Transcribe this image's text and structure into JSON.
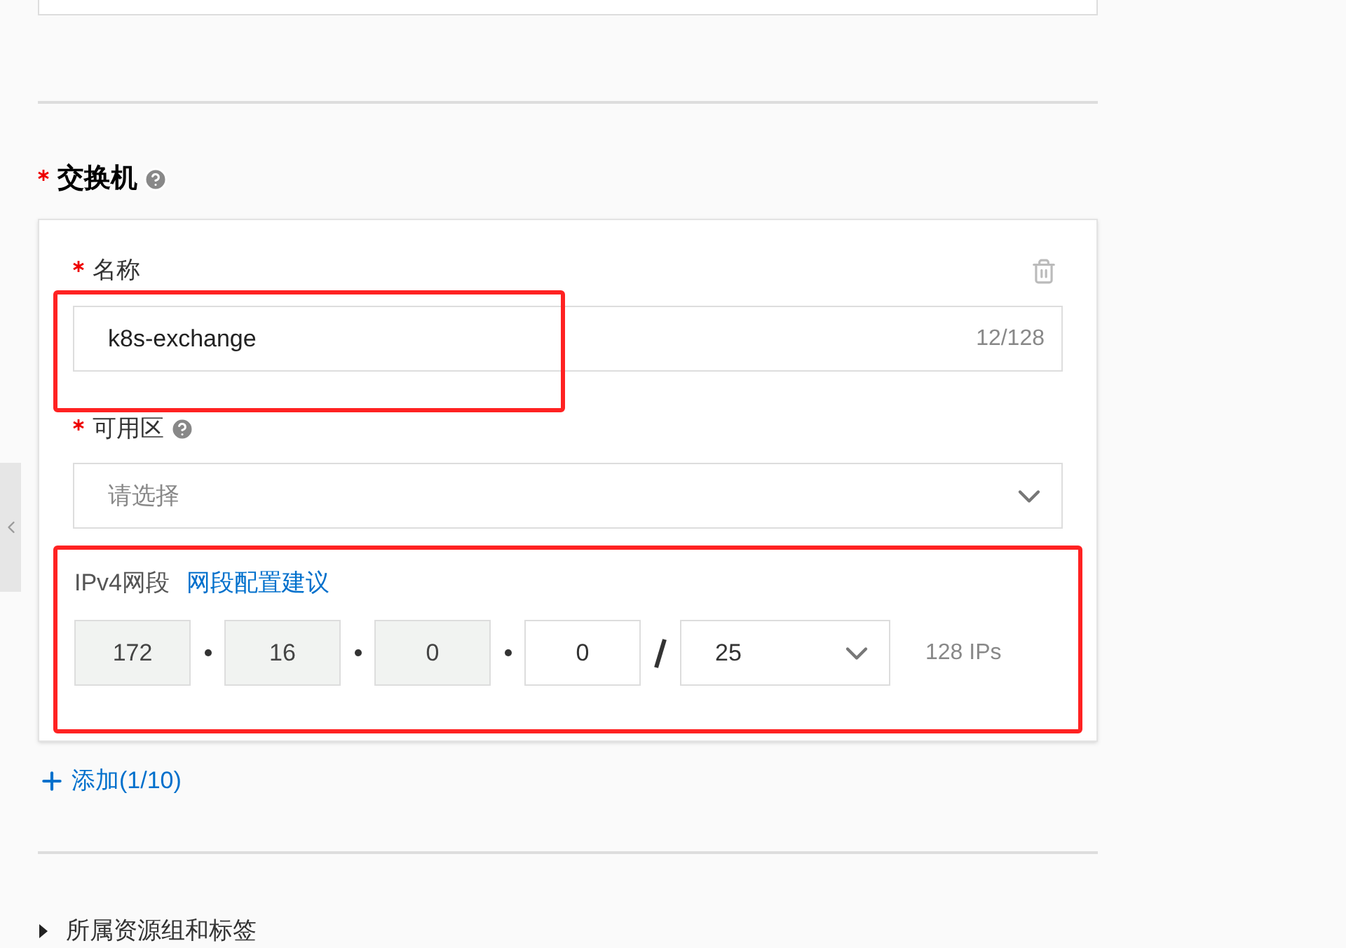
{
  "switch_section": {
    "title": "交换机",
    "required": true,
    "name_field": {
      "label": "名称",
      "required": true,
      "value": "k8s-exchange",
      "counter": "12/128"
    },
    "zone_field": {
      "label": "可用区",
      "required": true,
      "placeholder": "请选择"
    },
    "ipv4": {
      "label": "IPv4网段",
      "link": "网段配置建议",
      "octets": [
        {
          "value": "172",
          "disabled": true
        },
        {
          "value": "16",
          "disabled": true
        },
        {
          "value": "0",
          "disabled": true
        },
        {
          "value": "0",
          "disabled": false
        }
      ],
      "prefix": "25",
      "ip_count": "128 IPs"
    },
    "add_link": "添加(1/10)"
  },
  "collapsible": {
    "label": "所属资源组和标签",
    "expanded": false
  }
}
